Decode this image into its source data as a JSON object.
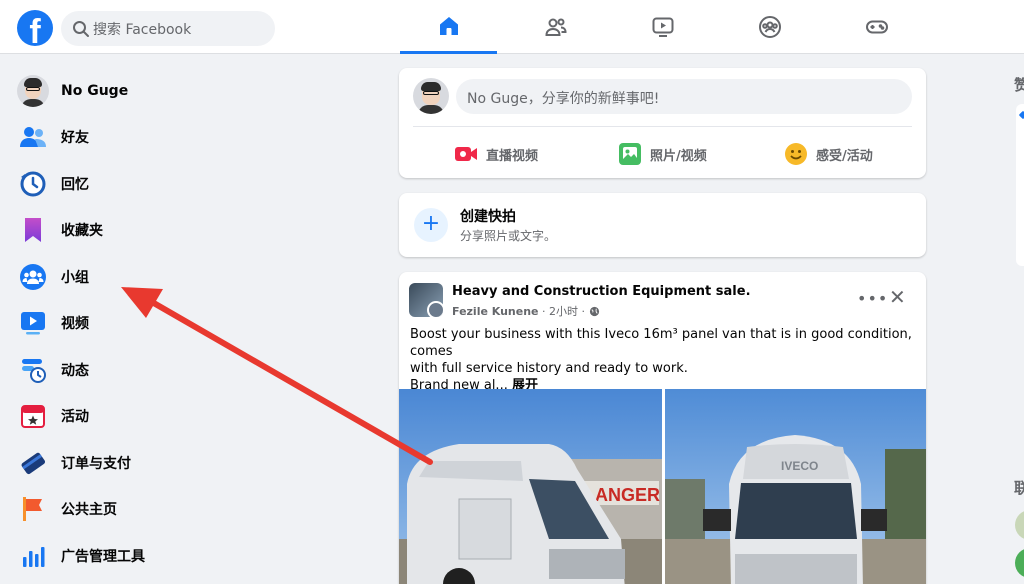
{
  "topbar": {
    "search_placeholder": "搜索 Facebook",
    "tabs": [
      "home-tab",
      "friends-tab",
      "watch-tab",
      "groups-tab",
      "gaming-tab"
    ]
  },
  "sidebar": {
    "items": [
      {
        "label": "No Guge",
        "icon": "profile-avatar"
      },
      {
        "label": "好友",
        "icon": "friends-icon"
      },
      {
        "label": "回忆",
        "icon": "memories-icon"
      },
      {
        "label": "收藏夹",
        "icon": "saved-icon"
      },
      {
        "label": "小组",
        "icon": "groups-icon"
      },
      {
        "label": "视频",
        "icon": "video-icon"
      },
      {
        "label": "动态",
        "icon": "feeds-icon"
      },
      {
        "label": "活动",
        "icon": "events-icon"
      },
      {
        "label": "订单与支付",
        "icon": "orders-payments-icon"
      },
      {
        "label": "公共主页",
        "icon": "pages-icon"
      },
      {
        "label": "广告管理工具",
        "icon": "ads-manager-icon"
      }
    ]
  },
  "composer": {
    "placeholder": "No Guge，分享你的新鲜事吧!",
    "actions": [
      {
        "label": "直播视频",
        "icon": "live-video-icon",
        "color": "#f02849"
      },
      {
        "label": "照片/视频",
        "icon": "photo-video-icon",
        "color": "#45bd62"
      },
      {
        "label": "感受/活动",
        "icon": "feeling-icon",
        "color": "#f7b928"
      }
    ]
  },
  "story": {
    "title": "创建快拍",
    "subtitle": "分享照片或文字。"
  },
  "post": {
    "group_name": "Heavy and Construction Equipment sale.",
    "author": "Fezile Kunene",
    "time": "2小时",
    "text_line1": "Boost your business with this Iveco 16m³  panel van that is in good condition, comes",
    "text_line2": "with full service history and ready to work.",
    "text_line3": "Brand new al...",
    "see_more": "展开",
    "photo_right_brand": "IVECO",
    "photo_left_sign": "ANGER"
  },
  "right_column": {
    "sponsored_heading": "赞",
    "contacts_heading": "联"
  },
  "colors": {
    "brand": "#1877f2",
    "annotation_arrow": "#e8392f"
  }
}
